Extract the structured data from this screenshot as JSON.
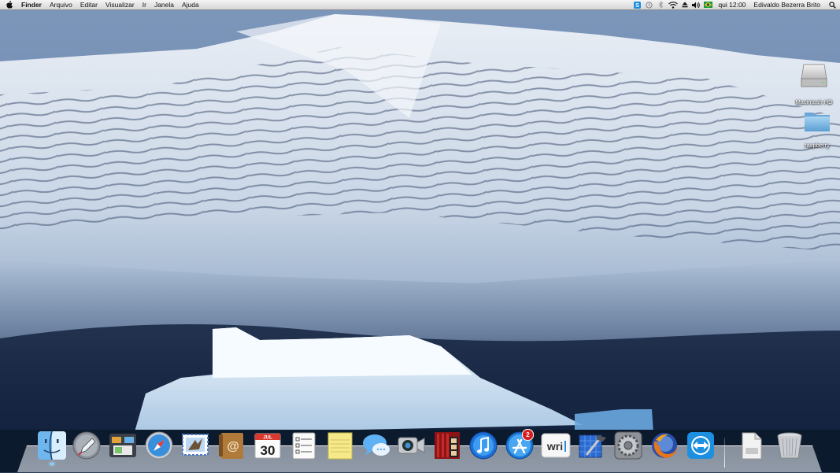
{
  "menubar": {
    "app_name": "Finder",
    "menus": [
      "Arquivo",
      "Editar",
      "Visualizar",
      "Ir",
      "Janela",
      "Ajuda"
    ],
    "clock": "qui 12:00",
    "user": "Edivaldo Bezerra Brito",
    "tray_icons": [
      "skype-icon",
      "time-machine-icon",
      "bluetooth-icon",
      "wifi-icon",
      "eject-icon",
      "volume-icon",
      "brazil-flag-icon",
      "spotlight-icon"
    ]
  },
  "desktop": {
    "icons": [
      {
        "label": "Macintosh HD",
        "icon": "hard-drive-icon"
      },
      {
        "label": "raspberry",
        "icon": "folder-icon"
      }
    ]
  },
  "dock": {
    "calendar_day": "30",
    "calendar_month": "JUL",
    "app_store_badge": "2",
    "writer_text": "wri",
    "apps": [
      "Finder",
      "Launchpad",
      "Mission Control",
      "Safari",
      "Mail",
      "Contacts",
      "Calendar",
      "Reminders",
      "Notes",
      "Messages",
      "FaceTime",
      "Photo Booth",
      "iTunes",
      "App Store",
      "Writer",
      "Xcode",
      "System Preferences",
      "Firefox",
      "TeamViewer",
      "Downloads",
      "Trash"
    ]
  },
  "colors": {
    "sky": "#6f8cb2",
    "snow": "#dfe8f2",
    "iceberg": "#e6f1fa",
    "water": "#0c1a2e"
  }
}
